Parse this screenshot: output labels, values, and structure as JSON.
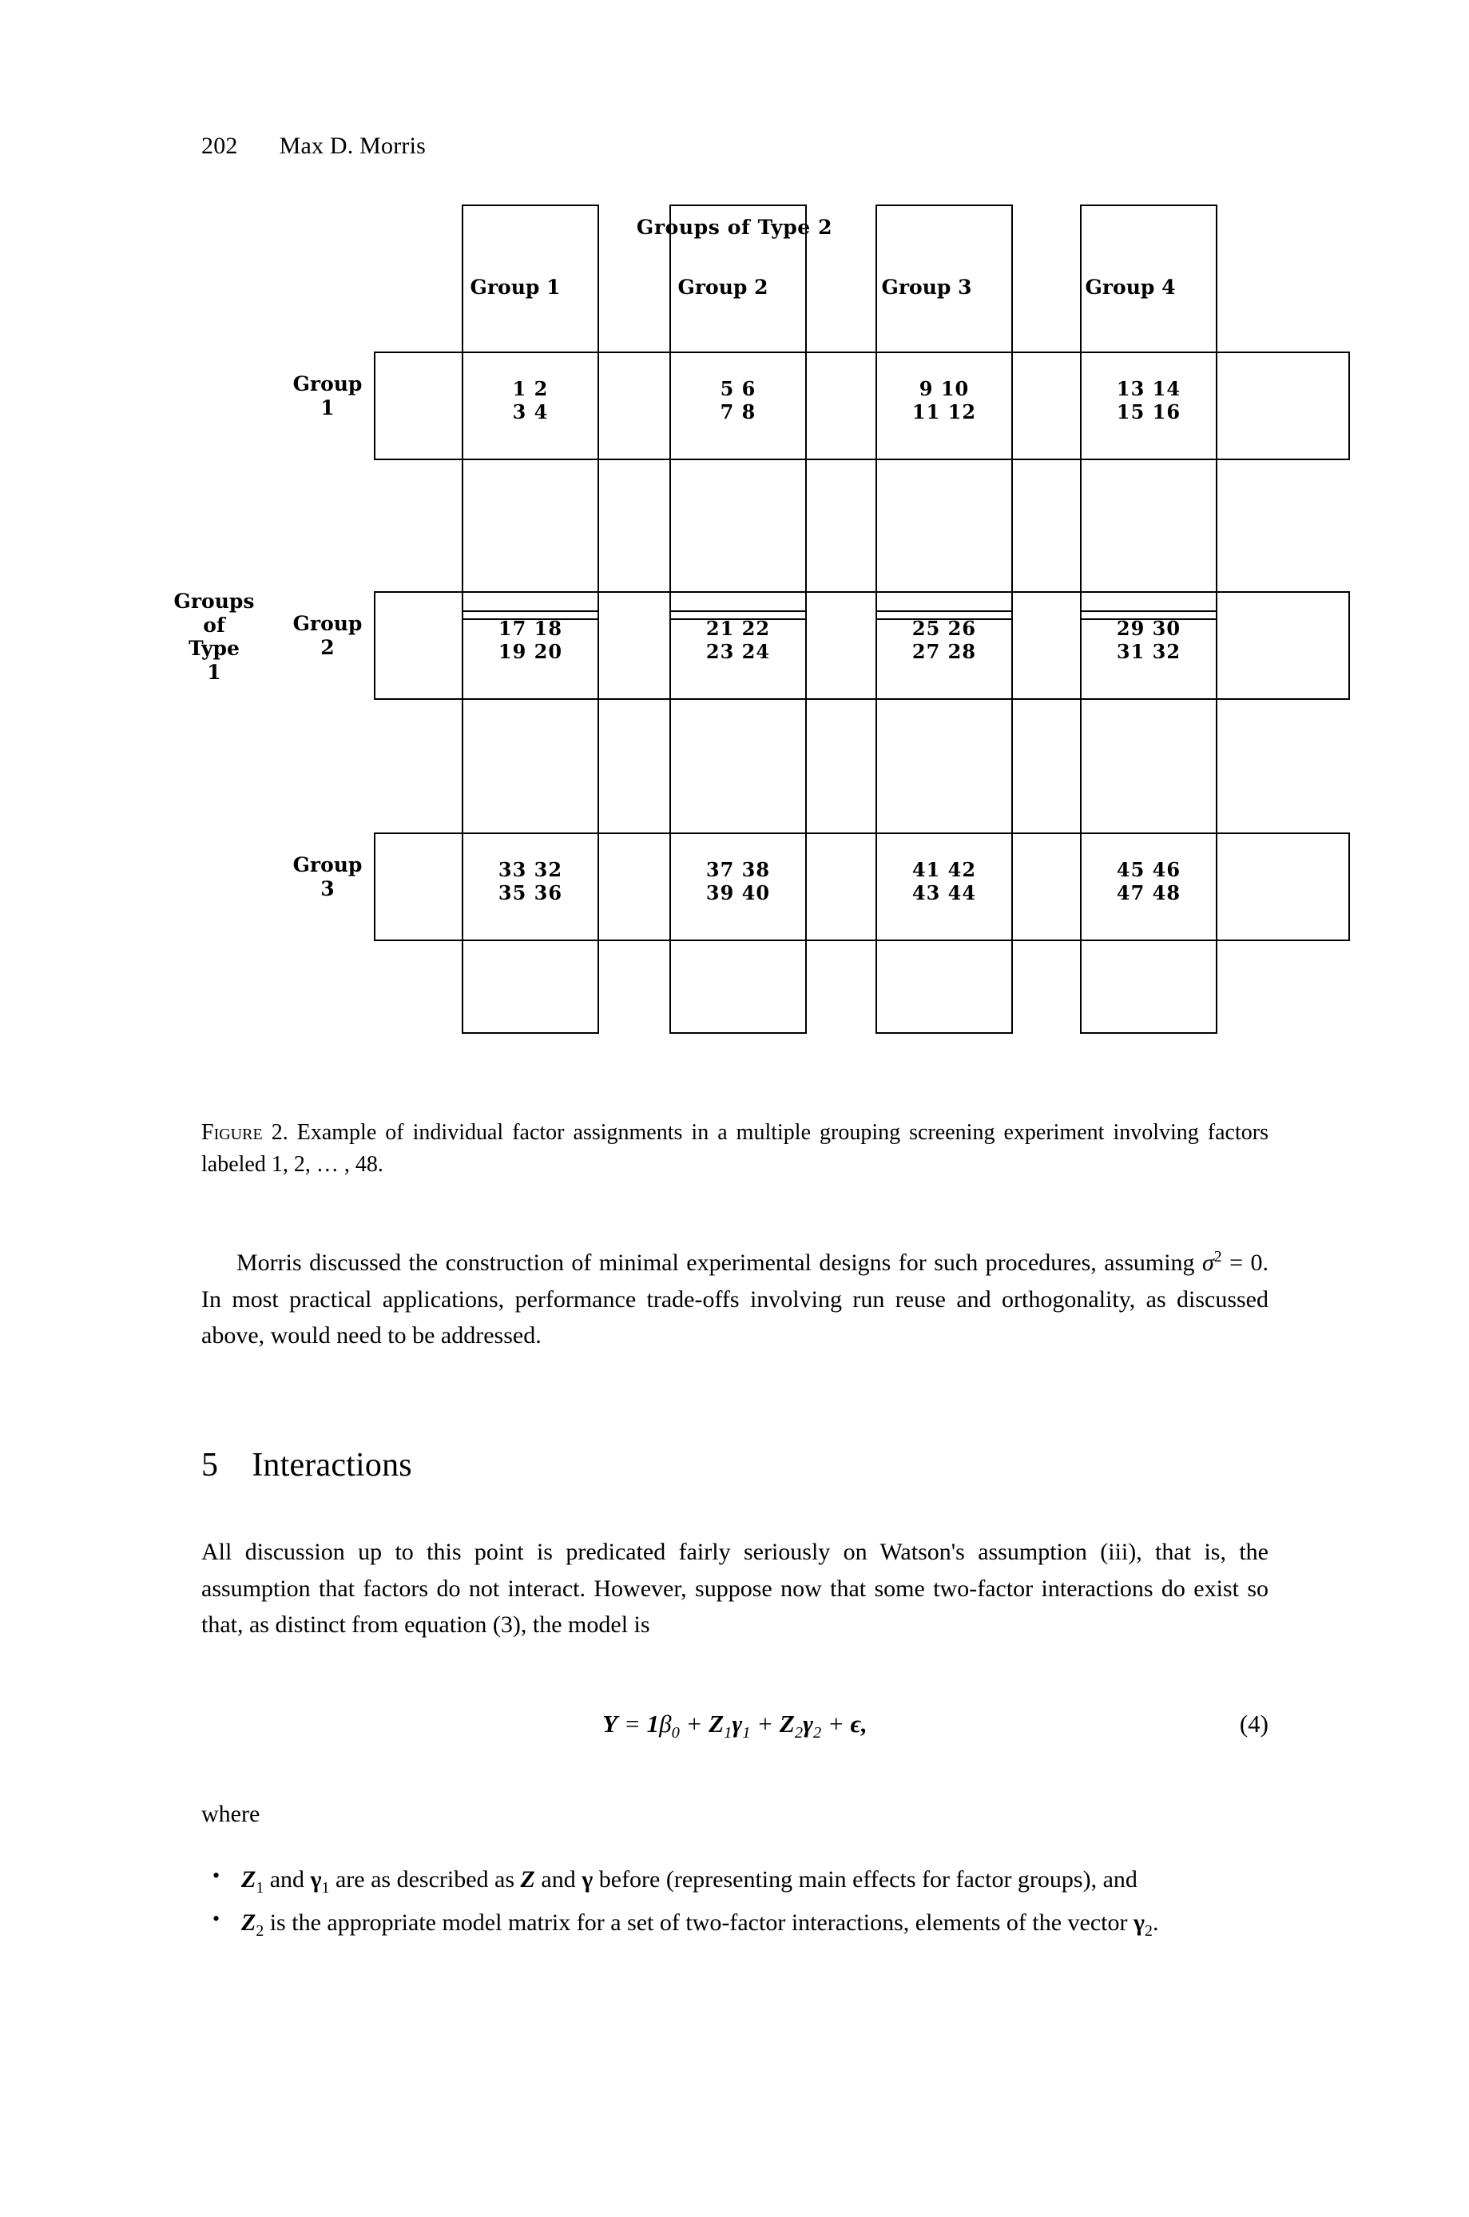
{
  "header": {
    "folio": "202",
    "author": "Max D. Morris"
  },
  "figure": {
    "title": "Groups of Type 2",
    "row_axis_label_lines": [
      "Groups",
      "of",
      "Type",
      "1"
    ],
    "column_headers": [
      "Group 1",
      "Group 2",
      "Group 3",
      "Group 4"
    ],
    "row_headers": [
      {
        "line1": "Group",
        "line2": "1"
      },
      {
        "line1": "Group",
        "line2": "2"
      },
      {
        "line1": "Group",
        "line2": "3"
      }
    ],
    "cells": [
      [
        {
          "top": "1  2",
          "bottom": "3  4"
        },
        {
          "top": "5  6",
          "bottom": "7  8"
        },
        {
          "top": "9 10",
          "bottom": "11 12"
        },
        {
          "top": "13 14",
          "bottom": "15 16"
        }
      ],
      [
        {
          "top": "17 18",
          "bottom": "19 20"
        },
        {
          "top": "21 22",
          "bottom": "23 24"
        },
        {
          "top": "25 26",
          "bottom": "27 28"
        },
        {
          "top": "29 30",
          "bottom": "31 32"
        }
      ],
      [
        {
          "top": "33 32",
          "bottom": "35 36"
        },
        {
          "top": "37 38",
          "bottom": "39 40"
        },
        {
          "top": "41 42",
          "bottom": "43 44"
        },
        {
          "top": "45 46",
          "bottom": "47 48"
        }
      ]
    ],
    "line_color": "#000000"
  },
  "caption": {
    "label": "Figure 2.",
    "text": "Example of individual factor assignments in a multiple grouping screening experiment involving factors labeled 1, 2, … , 48."
  },
  "body": {
    "paragraph1_a": "Morris discussed the construction of minimal experimental designs for such procedures, assuming ",
    "paragraph1_sigma": "σ",
    "paragraph1_sigma_exp": "2",
    "paragraph1_b": " = 0. In most practical applications, performance trade-offs involving run reuse and orthogonality, as discussed above, would need to be addressed.",
    "section_number": "5",
    "section_title": "Interactions",
    "paragraph2": "All discussion up to this point is predicated fairly seriously on Watson's assumption (iii), that is, the assumption that factors do not interact. However, suppose now that some two-factor interactions do exist so that, as distinct from equation (3), the model is",
    "where_word": "where",
    "equation": {
      "lhs": "Y",
      "eq": " = ",
      "rhs": "1β₀ + Z₁γ₁ + Z₂γ₂ + ε,",
      "tag": "(4)",
      "parts": {
        "Y": "Y",
        "one": "1",
        "beta": "β",
        "beta_sub": "0",
        "Z1": "Z",
        "Z1_sub": "1",
        "gamma1": "γ",
        "gamma1_sub": "1",
        "Z2": "Z",
        "Z2_sub": "2",
        "gamma2": "γ",
        "gamma2_sub": "2",
        "eps": "ϵ,"
      }
    },
    "bullets": [
      {
        "Z": "Z",
        "Z_sub": "1",
        "mid1": " and ",
        "gamma": "γ",
        "gamma_sub": "1",
        "mid2": " are as described as ",
        "Z_plain": "Z",
        "mid3": " and ",
        "gamma_plain": "γ",
        "tail": " before (representing main effects for factor groups), and"
      },
      {
        "Z": "Z",
        "Z_sub": "2",
        "mid1": " is the appropriate model matrix for a set of two-factor interactions, elements of the vector ",
        "gamma": "γ",
        "gamma_sub": "2",
        "tail": "."
      }
    ]
  }
}
